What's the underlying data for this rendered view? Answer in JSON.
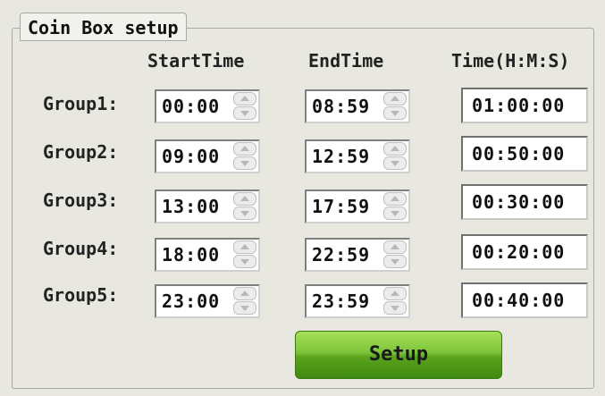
{
  "title": "Coin Box setup",
  "headers": {
    "start": "StartTime",
    "end": "EndTime",
    "duration": "Time(H:M:S)"
  },
  "groups": [
    {
      "label": "Group1:",
      "start": "00:00",
      "end": "08:59",
      "duration": "01:00:00"
    },
    {
      "label": "Group2:",
      "start": "09:00",
      "end": "12:59",
      "duration": "00:50:00"
    },
    {
      "label": "Group3:",
      "start": "13:00",
      "end": "17:59",
      "duration": "00:30:00"
    },
    {
      "label": "Group4:",
      "start": "18:00",
      "end": "22:59",
      "duration": "00:20:00"
    },
    {
      "label": "Group5:",
      "start": "23:00",
      "end": "23:59",
      "duration": "00:40:00"
    }
  ],
  "setup_label": "Setup"
}
